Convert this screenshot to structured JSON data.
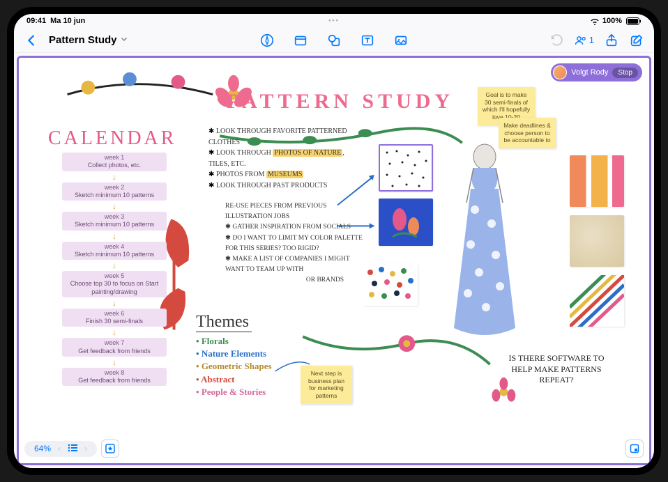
{
  "status": {
    "time": "09:41",
    "date": "Ma 10 jun",
    "battery": "100%"
  },
  "navbar": {
    "title": "Pattern Study",
    "collab_count": "1"
  },
  "follow": {
    "label": "Volgt Rody",
    "action": "Stop"
  },
  "board": {
    "title": "PATTERN STUDY",
    "calendar_title": "CALENDAR",
    "calendar": [
      {
        "week": "week 1",
        "text": "Collect photos, etc."
      },
      {
        "week": "week 2",
        "text": "Sketch minimum 10 patterns"
      },
      {
        "week": "week 3",
        "text": "Sketch minimum 10 patterns"
      },
      {
        "week": "week 4",
        "text": "Sketch minimum 10 patterns"
      },
      {
        "week": "week 5",
        "text": "Choose top 30 to focus on Start painting/drawing"
      },
      {
        "week": "week 6",
        "text": "Finish 30 semi-finals"
      },
      {
        "week": "week 7",
        "text": "Get feedback from friends"
      },
      {
        "week": "week 8",
        "text": "Get feedback from friends"
      }
    ],
    "notes1": {
      "a": "LOOK THROUGH FAVORITE PATTERNED CLOTHES",
      "b_pre": "LOOK THROUGH ",
      "b_hi": "PHOTOS OF NATURE",
      "b_post": ", TILES, ETC.",
      "c_pre": "PHOTOS FROM ",
      "c_hi": "MUSEUMS",
      "d": "LOOK THROUGH PAST PRODUCTS"
    },
    "notes2": {
      "a": "RE-USE PIECES FROM PREVIOUS ILLUSTRATION JOBS",
      "b": "✱ GATHER INSPIRATION FROM SOCIALS",
      "c": "✱ DO I WANT TO LIMIT MY COLOR PALETTE FOR THIS SERIES? TOO RIGID?",
      "d": "✱ MAKE A LIST OF COMPANIES I MIGHT WANT TO TEAM UP WITH",
      "e": "OR BRANDS"
    },
    "themes_title": "Themes",
    "themes": [
      {
        "label": "Florals",
        "cls": "t-green"
      },
      {
        "label": "Nature Elements",
        "cls": "t-blue"
      },
      {
        "label": "Geometric Shapes",
        "cls": "t-gold"
      },
      {
        "label": "Abstract",
        "cls": "t-red"
      },
      {
        "label": "People & Stories",
        "cls": "t-pink"
      }
    ],
    "sticky": {
      "goal": "Goal is to make 30 semi-finals of which I'll hopefully love 10-20",
      "deadline": "Make deadlines & choose person to be accountable to",
      "nextstep": "Next step is business plan for marketing patterns"
    },
    "question": "IS THERE SOFTWARE TO HELP MAKE PATTERNS REPEAT?"
  },
  "bottom": {
    "zoom": "64%"
  }
}
